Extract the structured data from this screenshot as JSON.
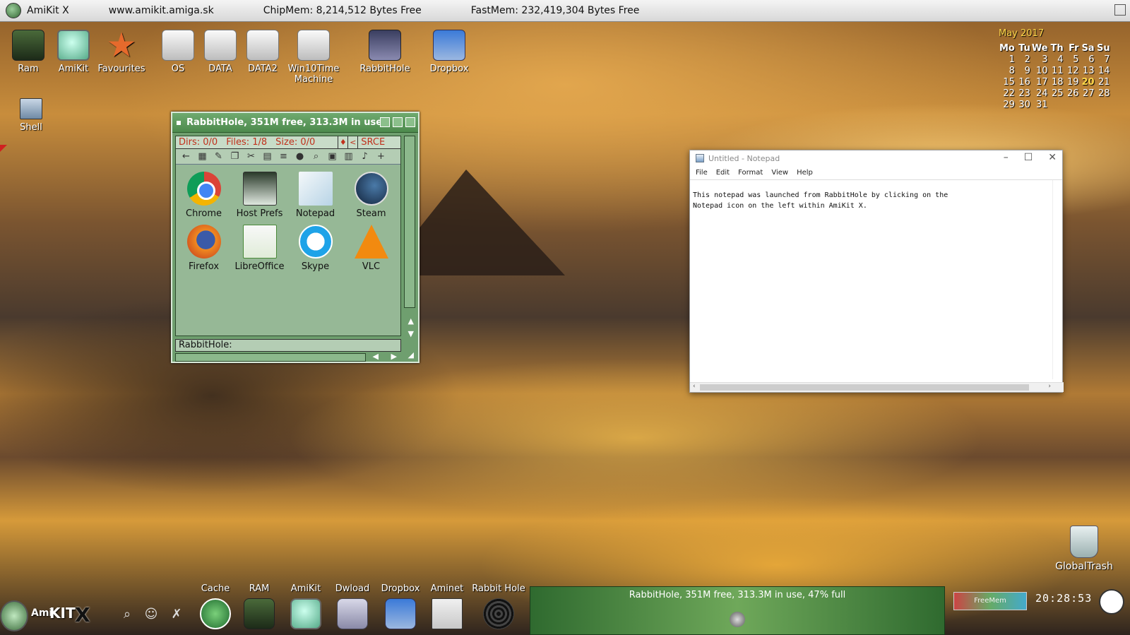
{
  "topbar": {
    "app": "AmiKit X",
    "url": "www.amikit.amiga.sk",
    "chipmem": "ChipMem: 8,214,512 Bytes Free",
    "fastmem": "FastMem: 232,419,304 Bytes Free"
  },
  "desktop_icons": [
    {
      "label": "Ram",
      "icon": "ram-icon"
    },
    {
      "label": "AmiKit",
      "icon": "amikit-icon"
    },
    {
      "label": "Favourites",
      "icon": "star-icon"
    },
    {
      "label": "OS",
      "icon": "drive-icon"
    },
    {
      "label": "DATA",
      "icon": "drive-icon"
    },
    {
      "label": "DATA2",
      "icon": "drive-icon"
    },
    {
      "label": "Win10Time Machine",
      "icon": "drive-icon"
    },
    {
      "label": "RabbitHole",
      "icon": "rabbithole-icon"
    },
    {
      "label": "Dropbox",
      "icon": "dropbox-icon"
    }
  ],
  "shell": {
    "label": "Shell",
    "icon": "shell-icon"
  },
  "calendar": {
    "title": "May  2017",
    "days": [
      "Mo",
      "Tu",
      "We",
      "Th",
      "Fr",
      "Sa",
      "Su"
    ],
    "weeks": [
      [
        "1",
        "2",
        "3",
        "4",
        "5",
        "6",
        "7"
      ],
      [
        "8",
        "9",
        "10",
        "11",
        "12",
        "13",
        "14"
      ],
      [
        "15",
        "16",
        "17",
        "18",
        "19",
        "20",
        "21"
      ],
      [
        "22",
        "23",
        "24",
        "25",
        "26",
        "27",
        "28"
      ],
      [
        "29",
        "30",
        "31",
        "",
        "",
        "",
        ""
      ]
    ],
    "today": "20"
  },
  "rabbithole_window": {
    "title": "RabbitHole,  351M free, 313.3M in use",
    "dirs": "Dirs: 0/0",
    "files": "Files: 1/8",
    "size": "Size: 0/0",
    "mode": "SRCE",
    "apps": [
      {
        "label": "Chrome",
        "icon": "chrome-icon"
      },
      {
        "label": "Host Prefs",
        "icon": "host-prefs-icon"
      },
      {
        "label": "Notepad",
        "icon": "notepad-icon"
      },
      {
        "label": "Steam",
        "icon": "steam-icon"
      },
      {
        "label": "Firefox",
        "icon": "firefox-icon"
      },
      {
        "label": "LibreOffice",
        "icon": "libreoffice-icon"
      },
      {
        "label": "Skype",
        "icon": "skype-icon"
      },
      {
        "label": "VLC",
        "icon": "vlc-icon"
      }
    ],
    "path": "RabbitHole:"
  },
  "notepad": {
    "title": "Untitled - Notepad",
    "menu": [
      "File",
      "Edit",
      "Format",
      "View",
      "Help"
    ],
    "content": "This notepad was launched from RabbitHole by clicking on the\nNotepad icon on the left within AmiKit X."
  },
  "trash": {
    "label": "GlobalTrash",
    "icon": "trash-icon"
  },
  "dock": {
    "brand_ami": "Ami",
    "brand_kit": "KIT",
    "brand_x": "X",
    "apps": [
      {
        "label": "Cache",
        "icon": "cache-icon"
      },
      {
        "label": "RAM",
        "icon": "ram-icon"
      },
      {
        "label": "AmiKit",
        "icon": "amikit-icon"
      },
      {
        "label": "Dwload",
        "icon": "download-icon"
      },
      {
        "label": "Dropbox",
        "icon": "dropbox-icon"
      },
      {
        "label": "Aminet",
        "icon": "aminet-icon"
      },
      {
        "label": "Rabbit Hole",
        "icon": "spiral-icon"
      }
    ],
    "info": "RabbitHole,  351M free, 313.3M in use, 47% full",
    "freemem_label": "FreeMem",
    "time": "20:28:53"
  }
}
